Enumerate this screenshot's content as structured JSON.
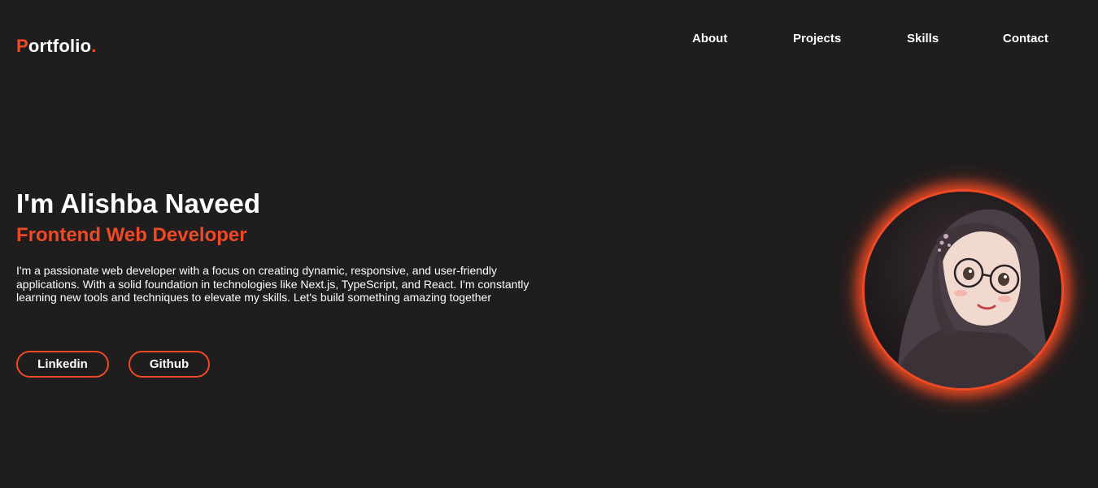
{
  "header": {
    "logo_initial": "P",
    "logo_rest": "ortfolio",
    "logo_dot": "."
  },
  "nav": {
    "items": [
      {
        "label": "About"
      },
      {
        "label": "Projects"
      },
      {
        "label": "Skills"
      },
      {
        "label": "Contact"
      }
    ]
  },
  "hero": {
    "name": "I'm Alishba Naveed",
    "role": "Frontend Web Developer",
    "description": "I'm a passionate web developer with a focus on creating dynamic, responsive, and user-friendly applications. With a solid foundation in technologies like Next.js, TypeScript, and React. I'm constantly learning new tools and techniques to elevate my skills. Let's build something amazing together",
    "buttons": [
      {
        "label": "Linkedin"
      },
      {
        "label": "Github"
      }
    ]
  },
  "colors": {
    "background": "#1f1d1e",
    "accent": "#f04a24",
    "text": "#ffffff"
  }
}
